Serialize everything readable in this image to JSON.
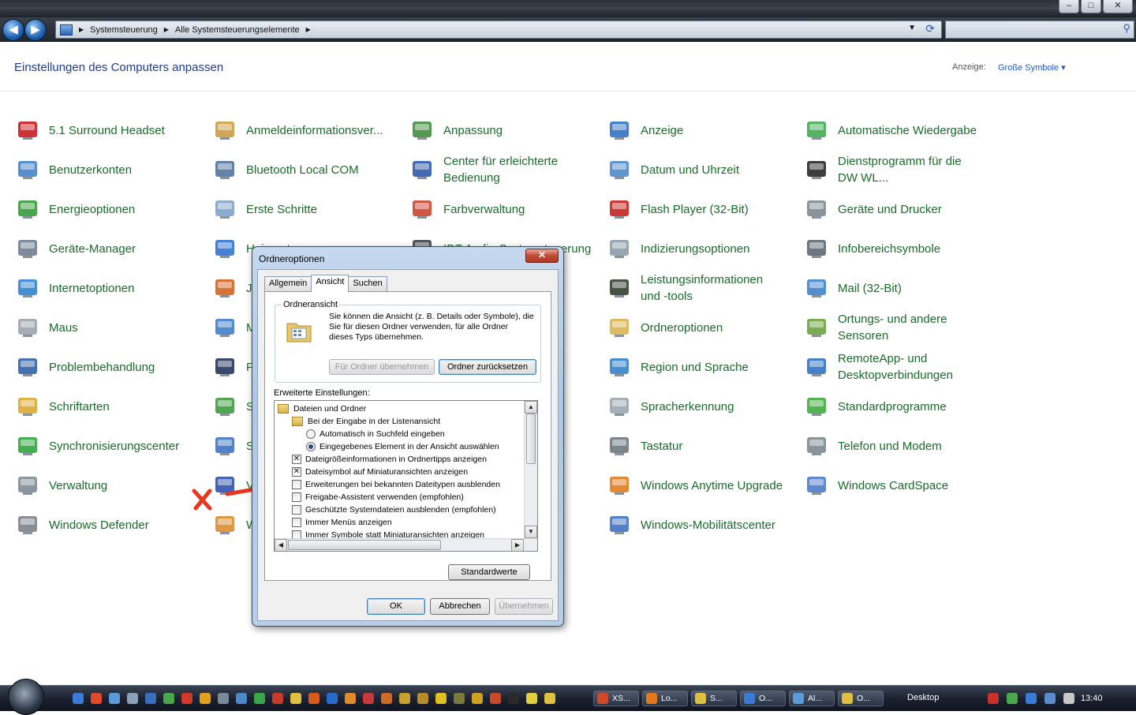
{
  "window": {
    "controls": [
      "–",
      "□",
      "✕"
    ]
  },
  "nav": {
    "breadcrumb": [
      "Systemsteuerung",
      "Alle Systemsteuerungselemente"
    ]
  },
  "header": {
    "title": "Einstellungen des Computers anpassen",
    "view_label": "Anzeige:",
    "view_value": "Große Symbole ▾"
  },
  "items": {
    "c1": [
      {
        "label": "5.1 Surround Headset",
        "icon": "speedlink-headset-icon",
        "color": "#c8151b"
      },
      {
        "label": "Benutzerkonten",
        "icon": "user-accounts-icon",
        "color": "#3e7fc7"
      },
      {
        "label": "Energieoptionen",
        "icon": "power-options-icon",
        "color": "#2e9a34"
      },
      {
        "label": "Geräte-Manager",
        "icon": "device-manager-icon",
        "color": "#6b7a8c"
      },
      {
        "label": "Internetoptionen",
        "icon": "internet-options-icon",
        "color": "#2a7fd0"
      },
      {
        "label": "Maus",
        "icon": "mouse-icon",
        "color": "#9aa2ab"
      },
      {
        "label": "Problembehandlung",
        "icon": "troubleshooting-icon",
        "color": "#2d5fa6"
      },
      {
        "label": "Schriftarten",
        "icon": "fonts-icon",
        "color": "#d9a72c"
      },
      {
        "label": "Synchronisierungscenter",
        "icon": "sync-center-icon",
        "color": "#2aa33a"
      },
      {
        "label": "Verwaltung",
        "icon": "administrative-tools-icon",
        "color": "#7b8794"
      },
      {
        "label": "Windows Defender",
        "icon": "windows-defender-icon",
        "color": "#7a7f86"
      }
    ],
    "c2": [
      {
        "label": "Anmeldeinformationsver...",
        "icon": "credential-manager-icon",
        "color": "#c99b3a"
      },
      {
        "label": "Bluetooth Local COM",
        "icon": "bluetooth-com-icon",
        "color": "#4f6f9a"
      },
      {
        "label": "Erste Schritte",
        "icon": "getting-started-icon",
        "color": "#7aa0c8"
      },
      {
        "label": "Heimnetzgruppe",
        "icon": "homegroup-icon",
        "color": "#2c6fd0"
      },
      {
        "label": "Java",
        "icon": "java-icon",
        "color": "#d2601a"
      },
      {
        "label": "Minianwendungen",
        "icon": "gadgets-icon",
        "color": "#3a7bc8"
      },
      {
        "label": "Programme",
        "icon": "programs-icon",
        "color": "#1d2f5a"
      },
      {
        "label": "Spracherkennung",
        "icon": "recovery-icon",
        "color": "#3a9a3a"
      },
      {
        "label": "Startmenü",
        "icon": "taskbar-start-icon",
        "color": "#3a6fc0"
      },
      {
        "label": "Verbindungen",
        "icon": "action-center-flag-icon",
        "color": "#2a4fa8"
      },
      {
        "label": "Windows Update",
        "icon": "windows-update-icon",
        "color": "#d98a2a"
      }
    ],
    "c3": [
      {
        "label": "Anpassung",
        "icon": "personalization-icon",
        "color": "#3d8a3a"
      },
      {
        "label": "Center für erleichterte Bedienung",
        "icon": "ease-of-access-icon",
        "color": "#2a55a8"
      },
      {
        "label": "Farbverwaltung",
        "icon": "color-management-icon",
        "color": "#c8402a"
      },
      {
        "label": "IDT Audio-Systemsteuerung",
        "icon": "idt-audio-icon",
        "color": "#3a3f45"
      }
    ],
    "c4": [
      {
        "label": "Anzeige",
        "icon": "display-icon",
        "color": "#2a6fc0"
      },
      {
        "label": "Datum und Uhrzeit",
        "icon": "date-time-icon",
        "color": "#4a87c8"
      },
      {
        "label": "Flash Player (32-Bit)",
        "icon": "flash-player-icon",
        "color": "#c41e1a"
      },
      {
        "label": "Indizierungsoptionen",
        "icon": "indexing-options-icon",
        "color": "#8a9aaa"
      },
      {
        "label": "Leistungsinformationen und -tools",
        "icon": "performance-icon",
        "color": "#2f3b2a"
      },
      {
        "label": "Ordneroptionen",
        "icon": "folder-options-icon",
        "color": "#d8b24a"
      },
      {
        "label": "Region und Sprache",
        "icon": "region-language-icon",
        "color": "#2f7fc8"
      },
      {
        "label": "Spracherkennung",
        "icon": "speech-recognition-icon",
        "color": "#9aa4ae"
      },
      {
        "label": "Tastatur",
        "icon": "keyboard-icon",
        "color": "#6a737c"
      },
      {
        "label": "Windows Anytime Upgrade",
        "icon": "anytime-upgrade-icon",
        "color": "#e07a1a"
      },
      {
        "label": "Windows-Mobilitätscenter",
        "icon": "mobility-center-icon",
        "color": "#3a6fc0"
      }
    ],
    "c5": [
      {
        "label": "Automatische Wiedergabe",
        "icon": "autoplay-icon",
        "color": "#3aa84a"
      },
      {
        "label": "Dienstprogramm für die DW WL...",
        "icon": "wireless-utility-icon",
        "color": "#222222"
      },
      {
        "label": "Geräte und Drucker",
        "icon": "devices-printers-icon",
        "color": "#7a8590"
      },
      {
        "label": "Infobereichsymbole",
        "icon": "notification-icons-icon",
        "color": "#5a6470"
      },
      {
        "label": "Mail (32-Bit)",
        "icon": "mail-icon",
        "color": "#3a7fc8"
      },
      {
        "label": "Ortungs- und andere Sensoren",
        "icon": "location-sensors-icon",
        "color": "#6aa03a"
      },
      {
        "label": "RemoteApp- und Desktopverbindungen",
        "icon": "remoteapp-icon",
        "color": "#2a6fc0"
      },
      {
        "label": "Standardprogramme",
        "icon": "default-programs-icon",
        "color": "#3aa83a"
      },
      {
        "label": "Telefon und Modem",
        "icon": "phone-modem-icon",
        "color": "#7a8590"
      },
      {
        "label": "Windows CardSpace",
        "icon": "cardspace-icon",
        "color": "#4a78c8"
      }
    ]
  },
  "dialog": {
    "title": "Ordneroptionen",
    "close": "✕",
    "tabs": [
      "Allgemein",
      "Ansicht",
      "Suchen"
    ],
    "group_title": "Ordneransicht",
    "group_text": "Sie können die Ansicht (z. B. Details oder Symbole), die Sie für diesen Ordner verwenden, für alle Ordner dieses Typs übernehmen.",
    "apply_btn": "Für Ordner übernehmen",
    "reset_btn": "Ordner zurücksetzen",
    "adv_label": "Erweiterte Einstellungen:",
    "tree": [
      {
        "type": "folder",
        "label": "Dateien und Ordner",
        "indent": 0
      },
      {
        "type": "folder",
        "label": "Bei der Eingabe in der Listenansicht",
        "indent": 1
      },
      {
        "type": "radio",
        "checked": false,
        "label": "Automatisch in Suchfeld eingeben",
        "indent": 2
      },
      {
        "type": "radio",
        "checked": true,
        "label": "Eingegebenes Element in der Ansicht auswählen",
        "indent": 2
      },
      {
        "type": "check",
        "checked": true,
        "label": "Dateigrößeinformationen in Ordnertipps anzeigen",
        "indent": 1
      },
      {
        "type": "check",
        "checked": true,
        "label": "Dateisymbol auf Miniaturansichten anzeigen",
        "indent": 1
      },
      {
        "type": "check",
        "checked": false,
        "label": "Erweiterungen bei bekannten Dateitypen ausblenden",
        "indent": 1
      },
      {
        "type": "check",
        "checked": false,
        "label": "Freigabe-Assistent verwenden (empfohlen)",
        "indent": 1
      },
      {
        "type": "check",
        "checked": false,
        "label": "Geschützte Systemdateien ausblenden (empfohlen)",
        "indent": 1
      },
      {
        "type": "check",
        "checked": false,
        "label": "Immer Menüs anzeigen",
        "indent": 1
      },
      {
        "type": "check",
        "checked": false,
        "label": "Immer Symbole statt Miniaturansichten anzeigen",
        "indent": 1
      }
    ],
    "defaults_btn": "Standardwerte",
    "ok": "OK",
    "cancel": "Abbrechen",
    "apply": "Übernehmen"
  },
  "annotation": {
    "color": "#e8361e"
  },
  "taskbar": {
    "buttons": [
      "XS...",
      "Lo...",
      "S...",
      "O...",
      "Al...",
      "O..."
    ],
    "desktop": "Desktop",
    "clock": "13:40"
  }
}
